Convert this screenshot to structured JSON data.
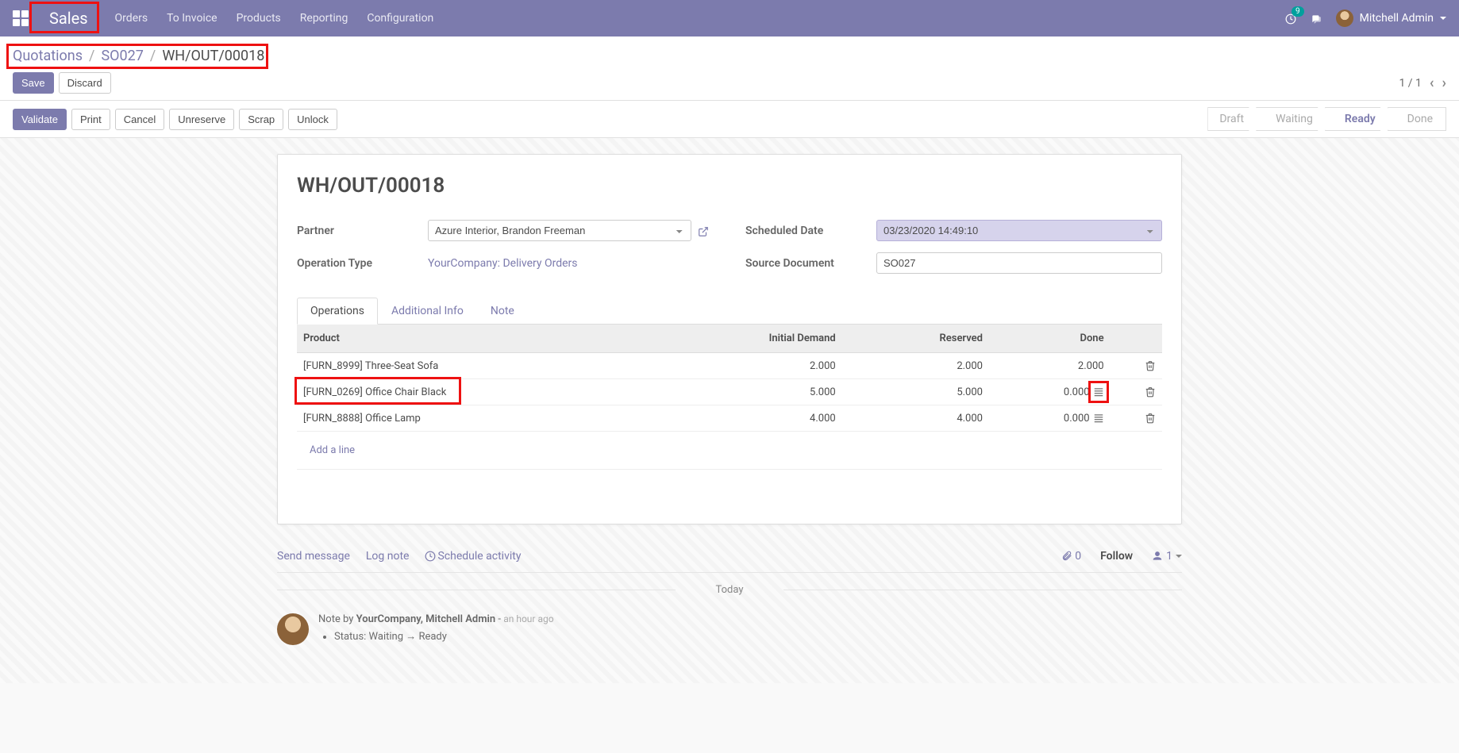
{
  "navbar": {
    "brand": "Sales",
    "menu": [
      "Orders",
      "To Invoice",
      "Products",
      "Reporting",
      "Configuration"
    ],
    "notif_count": "9",
    "user": "Mitchell Admin"
  },
  "breadcrumb": {
    "items": [
      "Quotations",
      "SO027"
    ],
    "current": "WH/OUT/00018"
  },
  "cp_buttons": {
    "save": "Save",
    "discard": "Discard"
  },
  "pager": {
    "text": "1 / 1"
  },
  "actions": {
    "validate": "Validate",
    "print": "Print",
    "cancel": "Cancel",
    "unreserve": "Unreserve",
    "scrap": "Scrap",
    "unlock": "Unlock"
  },
  "status": {
    "steps": [
      "Draft",
      "Waiting",
      "Ready",
      "Done"
    ],
    "active_index": 2
  },
  "record": {
    "title": "WH/OUT/00018",
    "labels": {
      "partner": "Partner",
      "operation_type": "Operation Type",
      "scheduled_date": "Scheduled Date",
      "source_doc": "Source Document"
    },
    "partner": "Azure Interior, Brandon Freeman",
    "operation_type": "YourCompany: Delivery Orders",
    "scheduled_date": "03/23/2020 14:49:10",
    "source_doc": "SO027"
  },
  "tabs": {
    "operations": "Operations",
    "additional_info": "Additional Info",
    "note": "Note"
  },
  "table": {
    "headers": {
      "product": "Product",
      "initial_demand": "Initial Demand",
      "reserved": "Reserved",
      "done": "Done"
    },
    "rows": [
      {
        "product": "[FURN_8999] Three-Seat Sofa",
        "initial_demand": "2.000",
        "reserved": "2.000",
        "done": "2.000",
        "has_detail": false
      },
      {
        "product": "[FURN_0269] Office Chair Black",
        "initial_demand": "5.000",
        "reserved": "5.000",
        "done": "0.000",
        "has_detail": true
      },
      {
        "product": "[FURN_8888] Office Lamp",
        "initial_demand": "4.000",
        "reserved": "4.000",
        "done": "0.000",
        "has_detail": true
      }
    ],
    "add_line": "Add a line"
  },
  "chatter": {
    "buttons": {
      "send": "Send message",
      "log": "Log note",
      "schedule": "Schedule activity"
    },
    "attach_count": "0",
    "follow": "Follow",
    "followers": "1",
    "today": "Today",
    "log_prefix": "Note by ",
    "log_author": "YourCompany, Mitchell Admin",
    "log_sep": " - ",
    "log_time": "an hour ago",
    "log_status_label": "Status: ",
    "log_status_from": "Waiting",
    "log_status_to": "Ready"
  }
}
